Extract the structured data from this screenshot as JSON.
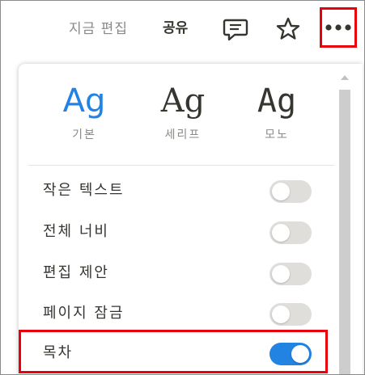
{
  "topbar": {
    "edit_status": "지금 편집",
    "share_label": "공유",
    "icons": [
      "comment-icon",
      "star-icon",
      "more-icon"
    ]
  },
  "menu": {
    "fonts": [
      {
        "sample": "Ag",
        "label": "기본",
        "selected": true
      },
      {
        "sample": "Ag",
        "label": "세리프",
        "selected": false
      },
      {
        "sample": "Ag",
        "label": "모노",
        "selected": false
      }
    ],
    "options": [
      {
        "label": "작은 텍스트",
        "on": false
      },
      {
        "label": "전체 너비",
        "on": false
      },
      {
        "label": "편집 제안",
        "on": false
      },
      {
        "label": "페이지 잠금",
        "on": false
      },
      {
        "label": "목차",
        "on": true
      }
    ]
  },
  "colors": {
    "accent": "#2383e2",
    "highlight_box": "#e8000b",
    "toggle_off": "#dfdedb",
    "muted_text": "#8a8986"
  }
}
